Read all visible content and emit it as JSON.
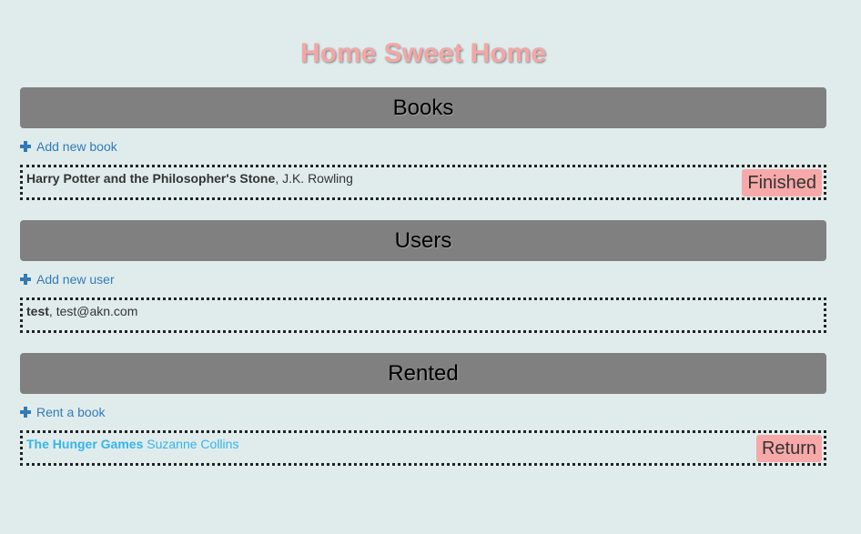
{
  "page": {
    "title": "Home Sweet Home"
  },
  "books": {
    "header": "Books",
    "add_label": "Add new book",
    "items": [
      {
        "title": "Harry Potter and the Philosopher's Stone",
        "separator": ", ",
        "author": "J.K. Rowling",
        "action": "Finished"
      }
    ]
  },
  "users": {
    "header": "Users",
    "add_label": "Add new user",
    "items": [
      {
        "name": "test",
        "separator": ", ",
        "email": "test@akn.com"
      }
    ]
  },
  "rented": {
    "header": "Rented",
    "add_label": "Rent a book",
    "items": [
      {
        "title": "The Hunger Games",
        "separator": " ",
        "author": "Suzanne Collins",
        "action": "Return"
      }
    ]
  },
  "colors": {
    "background": "#e0ecec",
    "title": "#f4a6a6",
    "header_bg": "#808080",
    "link": "#337ab7",
    "rented_text": "#36b5e8",
    "button_bg": "#f7a9a9"
  }
}
